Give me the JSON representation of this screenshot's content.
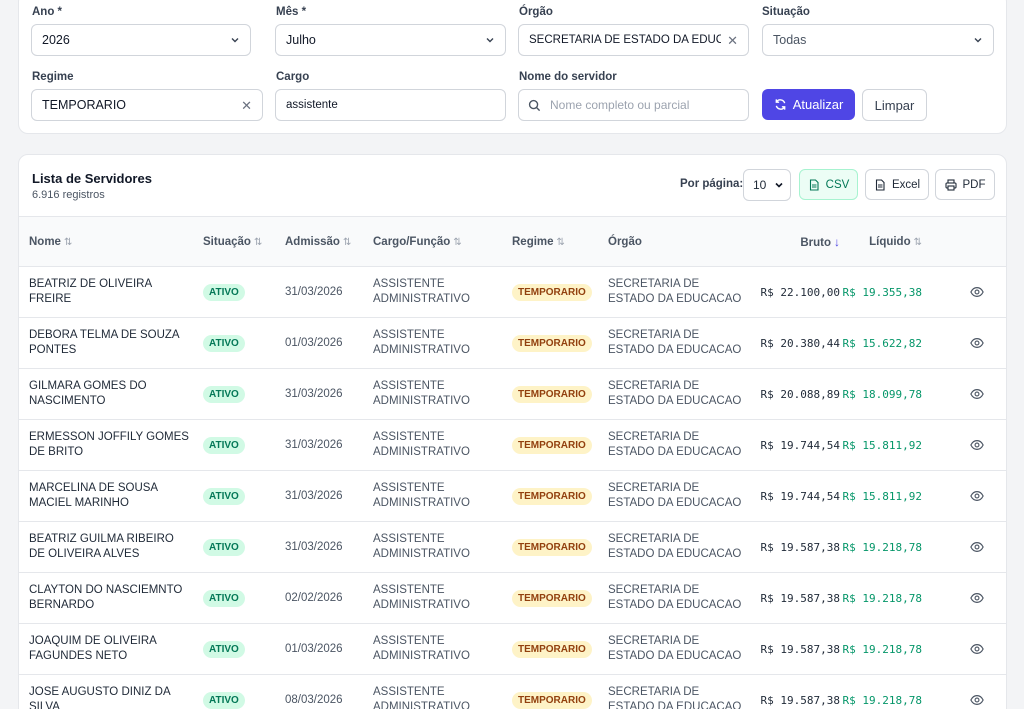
{
  "filters": {
    "ano": {
      "label": "Ano *",
      "value": "2026"
    },
    "mes": {
      "label": "Mês *",
      "value": "Julho"
    },
    "orgao": {
      "label": "Órgão",
      "value": "SECRETARIA DE ESTADO DA EDUCACAO"
    },
    "situacao": {
      "label": "Situação",
      "value": "Todas"
    },
    "regime": {
      "label": "Regime",
      "value": "TEMPORARIO"
    },
    "cargo": {
      "label": "Cargo",
      "value": "assistente"
    },
    "nome": {
      "label": "Nome do servidor",
      "placeholder": "Nome completo ou parcial"
    },
    "atualizar_label": "Atualizar",
    "limpar_label": "Limpar"
  },
  "list": {
    "title": "Lista de Servidores",
    "count": "6.916 registros",
    "per_page_label": "Por página:",
    "per_page_value": "10",
    "csv_label": "CSV",
    "excel_label": "Excel",
    "pdf_label": "PDF",
    "columns": [
      "Nome",
      "Situação",
      "Admissão",
      "Cargo/Função",
      "Regime",
      "Órgão",
      "Bruto",
      "Líquido"
    ]
  },
  "rows": [
    {
      "nome": "BEATRIZ DE OLIVEIRA FREIRE",
      "situacao": "ATIVO",
      "admissao": "31/03/2026",
      "cargo": "ASSISTENTE ADMINISTRATIVO",
      "regime": "TEMPORARIO",
      "orgao": "SECRETARIA DE ESTADO DA EDUCACAO",
      "bruto": "R$ 22.100,00",
      "liquido": "R$ 19.355,38"
    },
    {
      "nome": "DEBORA TELMA DE SOUZA PONTES",
      "situacao": "ATIVO",
      "admissao": "01/03/2026",
      "cargo": "ASSISTENTE ADMINISTRATIVO",
      "regime": "TEMPORARIO",
      "orgao": "SECRETARIA DE ESTADO DA EDUCACAO",
      "bruto": "R$ 20.380,44",
      "liquido": "R$ 15.622,82"
    },
    {
      "nome": "GILMARA GOMES DO NASCIMENTO",
      "situacao": "ATIVO",
      "admissao": "31/03/2026",
      "cargo": "ASSISTENTE ADMINISTRATIVO",
      "regime": "TEMPORARIO",
      "orgao": "SECRETARIA DE ESTADO DA EDUCACAO",
      "bruto": "R$ 20.088,89",
      "liquido": "R$ 18.099,78"
    },
    {
      "nome": "ERMESSON JOFFILY GOMES DE BRITO",
      "situacao": "ATIVO",
      "admissao": "31/03/2026",
      "cargo": "ASSISTENTE ADMINISTRATIVO",
      "regime": "TEMPORARIO",
      "orgao": "SECRETARIA DE ESTADO DA EDUCACAO",
      "bruto": "R$ 19.744,54",
      "liquido": "R$ 15.811,92"
    },
    {
      "nome": "MARCELINA DE SOUSA MACIEL MARINHO",
      "situacao": "ATIVO",
      "admissao": "31/03/2026",
      "cargo": "ASSISTENTE ADMINISTRATIVO",
      "regime": "TEMPORARIO",
      "orgao": "SECRETARIA DE ESTADO DA EDUCACAO",
      "bruto": "R$ 19.744,54",
      "liquido": "R$ 15.811,92"
    },
    {
      "nome": "BEATRIZ GUILMA RIBEIRO DE OLIVEIRA ALVES",
      "situacao": "ATIVO",
      "admissao": "31/03/2026",
      "cargo": "ASSISTENTE ADMINISTRATIVO",
      "regime": "TEMPORARIO",
      "orgao": "SECRETARIA DE ESTADO DA EDUCACAO",
      "bruto": "R$ 19.587,38",
      "liquido": "R$ 19.218,78"
    },
    {
      "nome": "CLAYTON DO NASCIEMNTO BERNARDO",
      "situacao": "ATIVO",
      "admissao": "02/02/2026",
      "cargo": "ASSISTENTE ADMINISTRATIVO",
      "regime": "TEMPORARIO",
      "orgao": "SECRETARIA DE ESTADO DA EDUCACAO",
      "bruto": "R$ 19.587,38",
      "liquido": "R$ 19.218,78"
    },
    {
      "nome": "JOAQUIM DE OLIVEIRA FAGUNDES NETO",
      "situacao": "ATIVO",
      "admissao": "01/03/2026",
      "cargo": "ASSISTENTE ADMINISTRATIVO",
      "regime": "TEMPORARIO",
      "orgao": "SECRETARIA DE ESTADO DA EDUCACAO",
      "bruto": "R$ 19.587,38",
      "liquido": "R$ 19.218,78"
    },
    {
      "nome": "JOSE AUGUSTO DINIZ DA SILVA",
      "situacao": "ATIVO",
      "admissao": "08/03/2026",
      "cargo": "ASSISTENTE ADMINISTRATIVO",
      "regime": "TEMPORARIO",
      "orgao": "SECRETARIA DE ESTADO DA EDUCACAO",
      "bruto": "R$ 19.587,38",
      "liquido": "R$ 19.218,78"
    }
  ]
}
